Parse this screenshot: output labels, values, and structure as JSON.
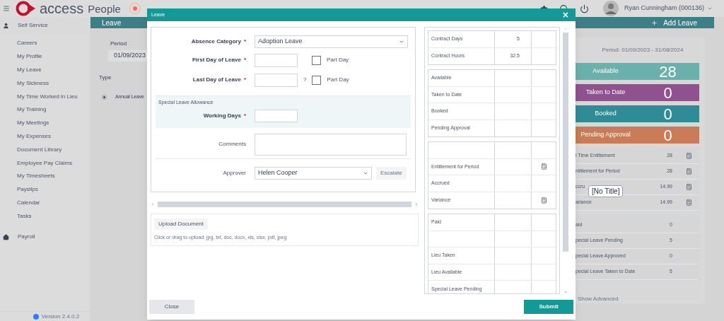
{
  "topbar": {
    "logo_text": "access",
    "product": "People",
    "user": "Ryan Cunningham (000136)"
  },
  "sidebar": {
    "sections": [
      {
        "label": "Self Service",
        "kind": "person",
        "children": [
          {
            "label": "Careers"
          },
          {
            "label": "My Profile"
          },
          {
            "label": "My Leave"
          },
          {
            "label": "My Sickness"
          },
          {
            "label": "My Time Worked in Lieu"
          },
          {
            "label": "My Training"
          },
          {
            "label": "My Meetings"
          },
          {
            "label": "My Expenses"
          },
          {
            "label": "Document Library"
          },
          {
            "label": "Employee Pay Claims"
          },
          {
            "label": "My Timesheets"
          },
          {
            "label": "Payslips"
          },
          {
            "label": "Calendar"
          },
          {
            "label": "Tasks"
          }
        ]
      },
      {
        "label": "Payroll",
        "kind": "home"
      }
    ],
    "version": "Version 2.4.0.2"
  },
  "header": {
    "title": "Leave",
    "action": "Add Leave"
  },
  "period": {
    "label": "Period",
    "value": "01/09/2023"
  },
  "types": {
    "heading": "Type",
    "items": [
      {
        "label": "Annual Leave",
        "selected": true
      }
    ]
  },
  "summary": {
    "period": "Period: 01/09/2023 - 31/08/2024",
    "tiles": [
      {
        "label": "Available",
        "value": "28",
        "color": "#6ab0ad"
      },
      {
        "label": "Taken to Date",
        "value": "0",
        "color": "#8f528f"
      },
      {
        "label": "Booked",
        "value": "0",
        "color": "#2f8c96"
      },
      {
        "label": "Pending Approval",
        "value": "0",
        "color": "#c97c55"
      }
    ],
    "groups": [
      [
        {
          "label": "l Time Entitlement",
          "value": "28",
          "calc": true
        },
        {
          "label": "ntitlement for Period",
          "value": "28",
          "calc": true
        },
        {
          "label": "ccru",
          "value": "14.99",
          "calc": true
        },
        {
          "label": "ariance",
          "value": "14.99",
          "calc": true
        }
      ],
      [
        {
          "label": "aid",
          "value": "0",
          "calc": false
        },
        {
          "label": "pecial Leave Pending",
          "value": "5",
          "calc": false
        },
        {
          "label": "pecial Leave Approved",
          "value": "0",
          "calc": false
        },
        {
          "label": "pecial Leave Taken to Date",
          "value": "5",
          "calc": false
        }
      ]
    ],
    "show_advanced": "Show Advanced"
  },
  "tooltip": "[No Title]",
  "modal": {
    "title": "Leave",
    "close": "×",
    "category": {
      "label": "Absence Category",
      "marker": "*",
      "value": "Adoption Leave"
    },
    "first_day": {
      "label": "First Day of Leave",
      "marker": "*",
      "part_day": {
        "label": "Part Day",
        "checked": false
      }
    },
    "last_day": {
      "label": "Last Day of Leave",
      "marker": "*",
      "hint": "?",
      "part_day": {
        "label": "Part Day",
        "checked": false
      }
    },
    "special": {
      "heading": "Special Leave Allowance",
      "label": "Working Days",
      "marker": "*"
    },
    "comments": {
      "label": "Comments"
    },
    "approver": {
      "label": "Approver",
      "value": "Helen Cooper",
      "button": "Escalate"
    },
    "upload": {
      "button": "Upload Document",
      "hint": "Click or drag to upload: jpg, txt, doc, docx, xls, xlsx, pdf, jpeg"
    },
    "stats": [
      [
        {
          "label": "Contract Days",
          "value": "5",
          "calc": false
        },
        {
          "label": "Contract Hours",
          "value": "32.5",
          "calc": false
        }
      ],
      [
        {
          "label": "Available",
          "calc": false
        },
        {
          "label": "Taken to Date",
          "calc": false
        },
        {
          "label": "Booked",
          "calc": false
        },
        {
          "label": "Pending Approval",
          "calc": false
        }
      ],
      [
        {
          "calc": false
        },
        {
          "label": "Entitlement for Period",
          "calc": true
        },
        {
          "label": "Accrued",
          "calc": false
        },
        {
          "label": "Variance",
          "calc": true
        }
      ],
      [
        {
          "label": "Paid",
          "calc": false
        },
        {
          "calc": false
        },
        {
          "label": "Lieu Taken",
          "calc": false
        },
        {
          "label": "Lieu Available",
          "calc": false
        },
        {
          "label": "Special Leave Pending",
          "calc": false
        }
      ]
    ],
    "buttons": {
      "close": "Close",
      "submit": "Submit"
    }
  }
}
